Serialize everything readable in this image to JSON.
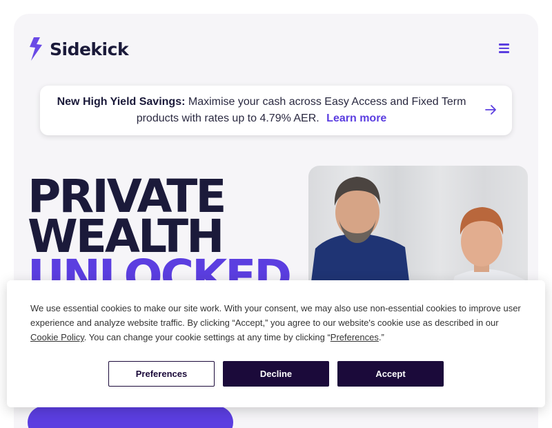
{
  "brand": {
    "name": "Sidekick",
    "accent": "#5b3ee0",
    "dark": "#1b1a3a"
  },
  "header": {
    "menu_icon": "hamburger-menu-icon"
  },
  "banner": {
    "title": "New High Yield Savings:",
    "text": "Maximise your cash across Easy Access and Fixed Term products with rates up to 4.79% AER.",
    "link": "Learn more",
    "arrow_icon": "arrow-right-icon"
  },
  "hero": {
    "line1": "PRIVATE",
    "line2": "WEALTH",
    "line3": "UNLOCKED"
  },
  "cookie": {
    "text_before_cookie_link": "We use essential cookies to make our site work. With your consent, we may also use non-essential cookies to improve user experience and analyze website traffic. By clicking “Accept,” you agree to our website's cookie use as described in our ",
    "cookie_policy_link": "Cookie Policy",
    "text_middle": ". You can change your cookie settings at any time by clicking “",
    "preferences_link": "Preferences",
    "text_end": ".”",
    "buttons": {
      "preferences": "Preferences",
      "decline": "Decline",
      "accept": "Accept"
    }
  }
}
